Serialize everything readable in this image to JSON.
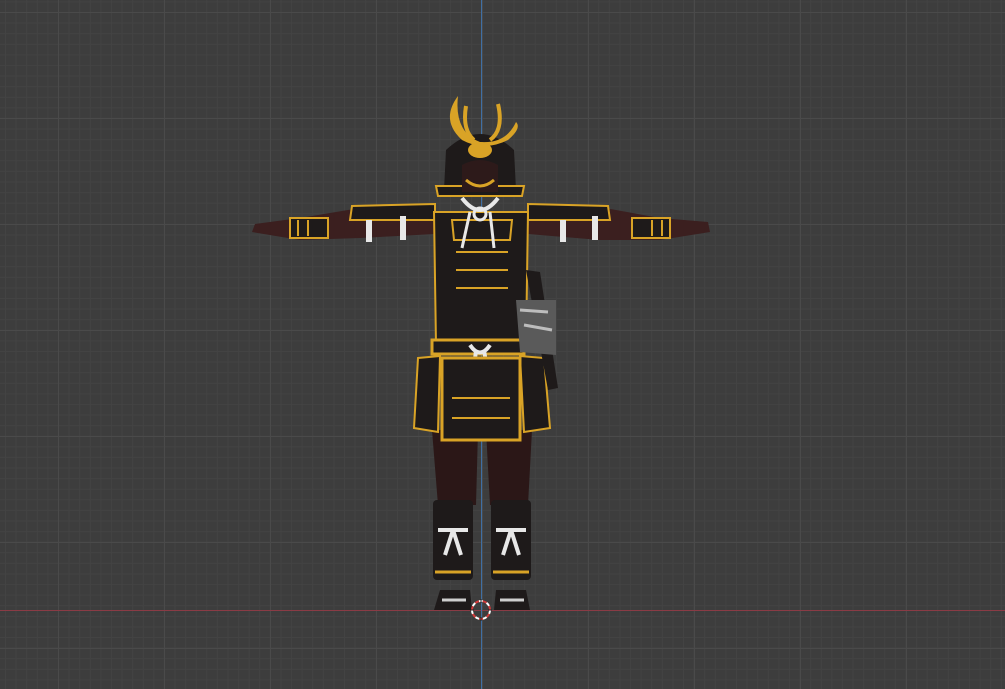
{
  "viewport": {
    "background": "#3d3d3d",
    "grid_major_color": "#4a4a4a",
    "grid_minor_color": "#434343",
    "x_axis_color": "#8a3b45",
    "z_axis_color": "#3f6fa4"
  },
  "model": {
    "subject": "samurai-armor-character-t-pose",
    "armor_color": "#1e1a1a",
    "trim_color": "#d9a326",
    "cord_color": "#e8e8e8",
    "skin_color": "#3b1f1f"
  },
  "cursor": {
    "icon": "3d-cursor-icon"
  }
}
